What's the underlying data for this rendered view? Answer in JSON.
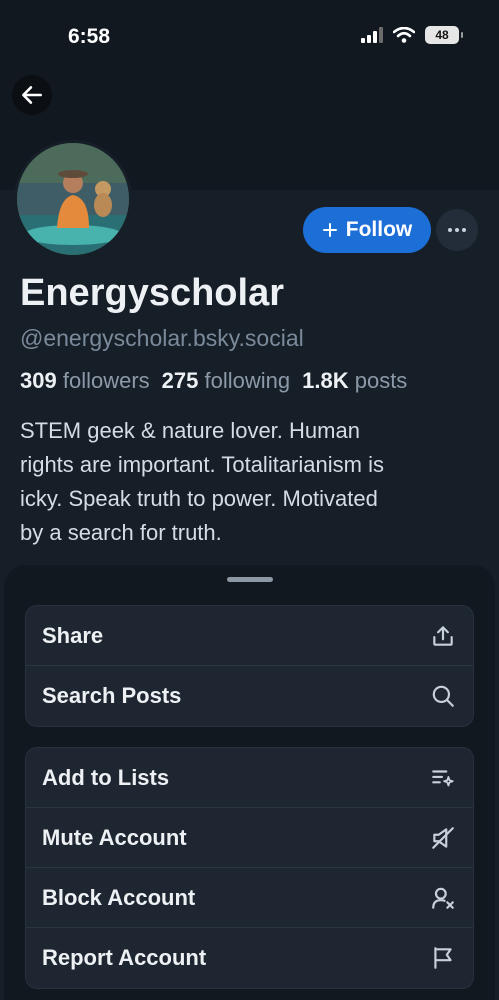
{
  "status_bar": {
    "time": "6:58",
    "battery": "48"
  },
  "profile": {
    "display_name": "Energyscholar",
    "handle": "@energyscholar.bsky.social",
    "followers_count": "309",
    "followers_label": "followers",
    "following_count": "275",
    "following_label": "following",
    "posts_count": "1.8K",
    "posts_label": "posts",
    "bio_lines": [
      "STEM geek & nature lover. Human",
      "rights are important. Totalitarianism is",
      "icky. Speak truth to power.  Motivated",
      "by a search for truth."
    ]
  },
  "actions": {
    "follow_label": "Follow"
  },
  "menu": {
    "group1": [
      {
        "label": "Share",
        "icon": "share-icon"
      },
      {
        "label": "Search Posts",
        "icon": "search-icon"
      }
    ],
    "group2": [
      {
        "label": "Add to Lists",
        "icon": "list-add-icon"
      },
      {
        "label": "Mute Account",
        "icon": "mute-icon"
      },
      {
        "label": "Block Account",
        "icon": "block-user-icon"
      },
      {
        "label": "Report Account",
        "icon": "flag-icon"
      }
    ]
  },
  "colors": {
    "accent": "#1d6fd8",
    "background": "#161e27",
    "sheet": "#111820"
  }
}
